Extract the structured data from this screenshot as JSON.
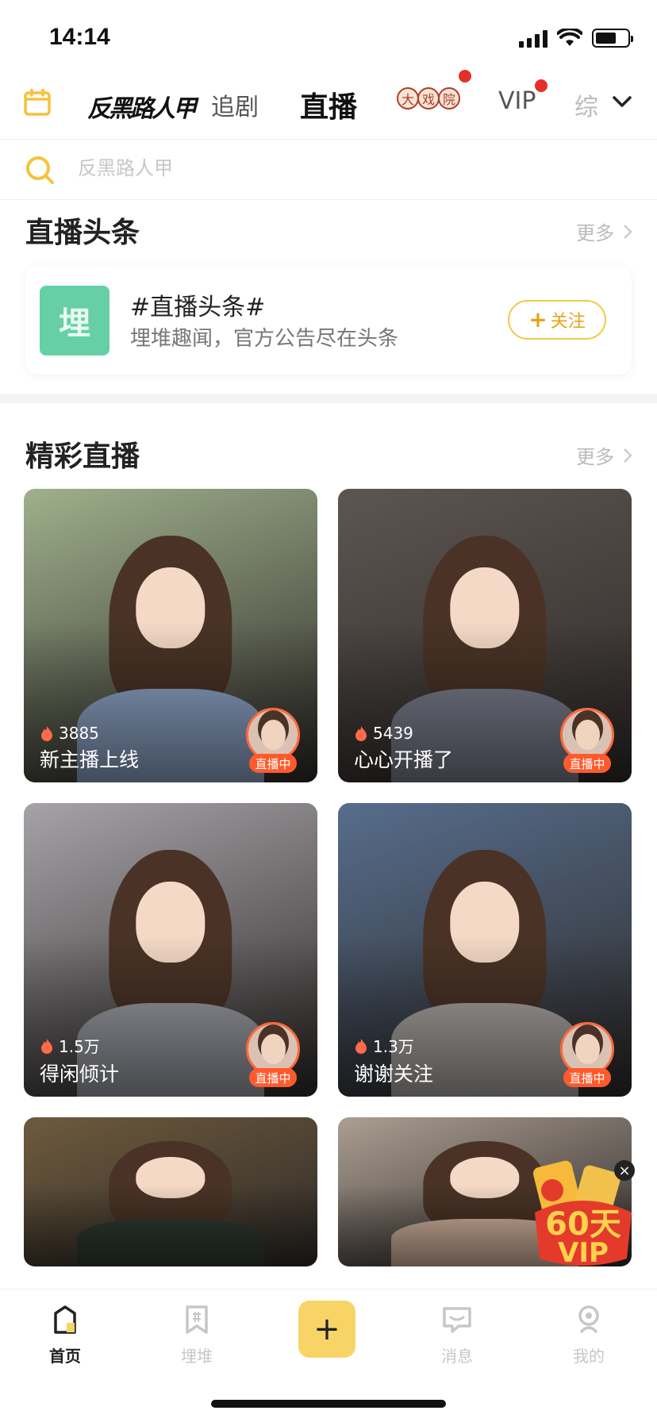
{
  "status_bar": {
    "time": "14:14"
  },
  "top_nav": {
    "brand": "反黑路人甲",
    "tabs": [
      {
        "label": "追剧",
        "active": false
      },
      {
        "label": "直播",
        "active": true
      },
      {
        "label": "大戏院",
        "active": false
      },
      {
        "label": "VIP",
        "active": false
      },
      {
        "label": "综",
        "active": false
      }
    ],
    "theater_chars": [
      "大",
      "戏",
      "院"
    ]
  },
  "search": {
    "placeholder": "反黑路人甲"
  },
  "headline": {
    "section_title": "直播头条",
    "more_label": "更多",
    "logo_char": "埋",
    "title": "#直播头条#",
    "subtitle": "埋堆趣闻，官方公告尽在头条",
    "follow_label": "关注"
  },
  "live": {
    "section_title": "精彩直播",
    "more_label": "更多",
    "live_badge": "直播中",
    "cards": [
      {
        "views": "3885",
        "title": "新主播上线",
        "bg": "#9fb08c",
        "body": "#8fa6c9"
      },
      {
        "views": "5439",
        "title": "心心开播了",
        "bg": "#5d5552",
        "body": "#7c7f8f"
      },
      {
        "views": "1.5万",
        "title": "得闲倾计",
        "bg": "#a6a3a8",
        "body": "#9ea0a8"
      },
      {
        "views": "1.3万",
        "title": "谢谢关注",
        "bg": "#566d8c",
        "body": "#ada8a5"
      },
      {
        "views": "",
        "title": "",
        "bg": "#6e5a3d",
        "body": "#2f3a32"
      },
      {
        "views": "",
        "title": "",
        "bg": "#ab9e92",
        "body": "#d6b6a0"
      }
    ]
  },
  "vip_promo": {
    "text": "60天VIP",
    "close": "×"
  },
  "tab_bar": {
    "items": [
      {
        "label": "首页",
        "active": true
      },
      {
        "label": "埋堆",
        "active": false
      },
      {
        "label": "消息",
        "active": false
      },
      {
        "label": "我的",
        "active": false
      }
    ],
    "plus_label": "+"
  },
  "colors": {
    "accent": "#f8d467",
    "live_red": "#ff5a2c",
    "follow_border": "#f2c843"
  }
}
